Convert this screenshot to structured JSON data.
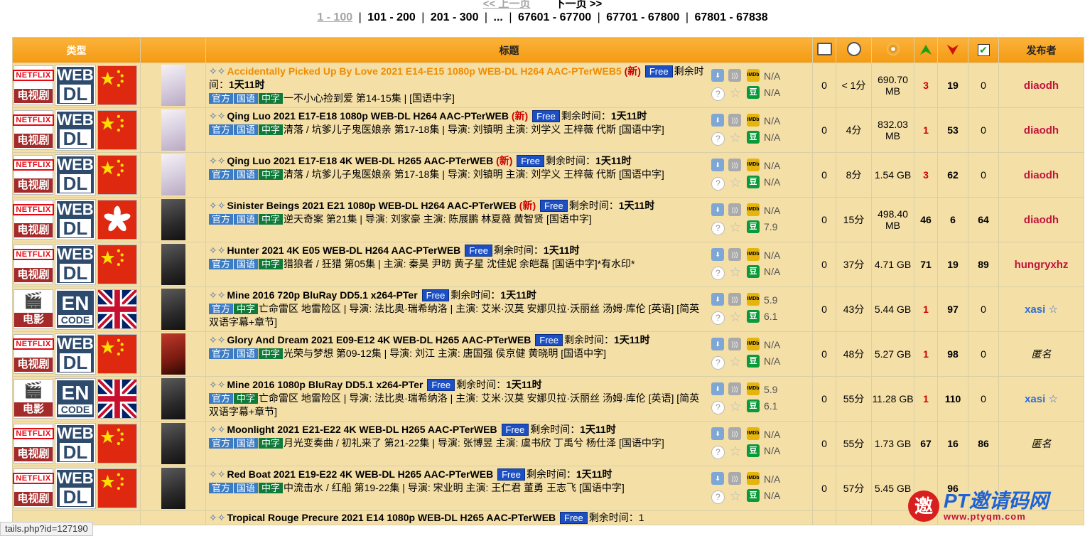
{
  "pager": {
    "prev_label": "<< 上一页",
    "next_label": "下一页 >>",
    "current": "1 - 100",
    "pages": [
      "101 - 200",
      "201 - 300",
      "...",
      "67601 - 67700",
      "67701 - 67800",
      "67801 - 67838"
    ]
  },
  "headers": {
    "type": "类型",
    "title": "标题",
    "publisher": "发布者"
  },
  "icons": {
    "comments": "comment-icon",
    "time": "clock-icon",
    "size": "disk-icon",
    "seeders": "up-arrow-icon",
    "leechers": "down-arrow-icon",
    "completed": "check-icon"
  },
  "labels": {
    "remaining": "剩余时间：",
    "free": "Free",
    "new": "(新)",
    "tag_official": "官方",
    "tag_mandarin": "国语",
    "tag_chinese_sub": "中字",
    "tag_english": "英语"
  },
  "rows": [
    {
      "cat": "电视剧",
      "cat_logo": "NETFLIX",
      "src": "WEB DL",
      "flag": "cn",
      "title": "Accidentally Picked Up By Love 2021 E14-E15 1080p WEB-DL H264 AAC-PTerWEB5",
      "hot": true,
      "new": true,
      "remain": "1天11时",
      "sub": "一不小心捡到爱 第14-15集 | [国语中字]",
      "tags": [
        "官方",
        "国语",
        "中字"
      ],
      "imdb": "N/A",
      "douban": "N/A",
      "comments": "0",
      "time": "< 1分",
      "size": "690.70 MB",
      "seeders": "3",
      "leechers": "19",
      "completed": "0",
      "publisher": "diaodh"
    },
    {
      "cat": "电视剧",
      "cat_logo": "NETFLIX",
      "src": "WEB DL",
      "flag": "cn",
      "title": "Qing Luo 2021 E17-E18 1080p WEB-DL H264 AAC-PTerWEB",
      "hot": false,
      "new": true,
      "remain": "1天11时",
      "sub": "清落 / 坑爹儿子鬼医娘亲 第17-18集 | 导演: 刘镇明 主演: 刘学义 王梓薇 代斯 [国语中字]",
      "tags": [
        "官方",
        "国语",
        "中字"
      ],
      "imdb": "N/A",
      "douban": "N/A",
      "comments": "0",
      "time": "4分",
      "size": "832.03 MB",
      "seeders": "1",
      "leechers": "53",
      "completed": "0",
      "publisher": "diaodh"
    },
    {
      "cat": "电视剧",
      "cat_logo": "NETFLIX",
      "src": "WEB DL",
      "flag": "cn",
      "title": "Qing Luo 2021 E17-E18 4K WEB-DL H265 AAC-PTerWEB",
      "hot": false,
      "new": true,
      "remain": "1天11时",
      "sub": "清落 / 坑爹儿子鬼医娘亲 第17-18集 | 导演: 刘镇明 主演: 刘学义 王梓薇 代斯 [国语中字]",
      "tags": [
        "官方",
        "国语",
        "中字"
      ],
      "imdb": "N/A",
      "douban": "N/A",
      "comments": "0",
      "time": "8分",
      "size": "1.54 GB",
      "seeders": "3",
      "leechers": "62",
      "completed": "0",
      "publisher": "diaodh"
    },
    {
      "cat": "电视剧",
      "cat_logo": "NETFLIX",
      "src": "WEB DL",
      "flag": "hk",
      "title": "Sinister Beings 2021 E21 1080p WEB-DL H264 AAC-PTerWEB",
      "hot": false,
      "new": true,
      "remain": "1天11时",
      "sub": "逆天奇案 第21集 | 导演: 刘家豪 主演: 陈展鹏 林夏薇 黄智贤 [国语中字]",
      "tags": [
        "官方",
        "国语",
        "中字"
      ],
      "imdb": "N/A",
      "douban": "7.9",
      "comments": "0",
      "time": "15分",
      "size": "498.40 MB",
      "seeders": "46",
      "leechers": "6",
      "completed": "64",
      "publisher": "diaodh"
    },
    {
      "cat": "电视剧",
      "cat_logo": "NETFLIX",
      "src": "WEB DL",
      "flag": "cn",
      "title": "Hunter 2021 4K E05 WEB-DL H264 AAC-PTerWEB",
      "hot": false,
      "new": false,
      "remain": "1天11时",
      "sub": "猎狼者 / 狂猎 第05集 | 主演: 秦昊 尹昉 黄子星 沈佳妮 余皑磊 [国语中字]*有水印*",
      "tags": [
        "官方",
        "国语",
        "中字"
      ],
      "imdb": "N/A",
      "douban": "N/A",
      "comments": "0",
      "time": "37分",
      "size": "4.71 GB",
      "seeders": "71",
      "leechers": "19",
      "completed": "89",
      "publisher": "hungryxhz"
    },
    {
      "cat": "电影",
      "cat_logo": "🎬",
      "src": "EN CODE",
      "flag": "uk",
      "title": "Mine 2016 720p BluRay DD5.1 x264-PTer",
      "hot": false,
      "new": false,
      "remain": "1天11时",
      "sub": "亡命雷区 地雷险区 | 导演: 法比奥·瑞希纳洛 | 主演: 艾米·汉莫 安娜贝拉·沃丽丝 汤姆·库伦 [英语] [简英双语字幕+章节]",
      "tags": [
        "官方",
        "中字"
      ],
      "imdb": "5.9",
      "douban": "6.1",
      "comments": "0",
      "time": "43分",
      "size": "5.44 GB",
      "seeders": "1",
      "leechers": "97",
      "completed": "0",
      "publisher": "xasi ☆"
    },
    {
      "cat": "电视剧",
      "cat_logo": "NETFLIX",
      "src": "WEB DL",
      "flag": "cn",
      "title": "Glory And Dream 2021 E09-E12 4K WEB-DL H265 AAC-PTerWEB",
      "hot": false,
      "new": false,
      "remain": "1天11时",
      "sub": "光荣与梦想 第09-12集 | 导演: 刘江 主演: 唐国强 侯京健 黄晓明 [国语中字]",
      "tags": [
        "官方",
        "国语",
        "中字"
      ],
      "imdb": "N/A",
      "douban": "N/A",
      "comments": "0",
      "time": "48分",
      "size": "5.27 GB",
      "seeders": "1",
      "leechers": "98",
      "completed": "0",
      "publisher": "匿名"
    },
    {
      "cat": "电影",
      "cat_logo": "🎬",
      "src": "EN CODE",
      "flag": "uk",
      "title": "Mine 2016 1080p BluRay DD5.1 x264-PTer",
      "hot": false,
      "new": false,
      "remain": "1天11时",
      "sub": "亡命雷区 地雷险区 | 导演: 法比奥·瑞希纳洛 | 主演: 艾米·汉莫 安娜贝拉·沃丽丝 汤姆·库伦 [英语] [简英双语字幕+章节]",
      "tags": [
        "官方",
        "中字"
      ],
      "imdb": "5.9",
      "douban": "6.1",
      "comments": "0",
      "time": "55分",
      "size": "11.28 GB",
      "seeders": "1",
      "leechers": "110",
      "completed": "0",
      "publisher": "xasi ☆"
    },
    {
      "cat": "电视剧",
      "cat_logo": "NETFLIX",
      "src": "WEB DL",
      "flag": "cn",
      "title": "Moonlight 2021 E21-E22 4K WEB-DL H265 AAC-PTerWEB",
      "hot": false,
      "new": false,
      "remain": "1天11时",
      "sub": "月光变奏曲 / 初礼来了 第21-22集 | 导演: 张博昱 主演: 虞书欣 丁禹兮 杨仕泽 [国语中字]",
      "tags": [
        "官方",
        "国语",
        "中字"
      ],
      "imdb": "N/A",
      "douban": "N/A",
      "comments": "0",
      "time": "55分",
      "size": "1.73 GB",
      "seeders": "67",
      "leechers": "16",
      "completed": "86",
      "publisher": "匿名"
    },
    {
      "cat": "电视剧",
      "cat_logo": "NETFLIX",
      "src": "WEB DL",
      "flag": "cn",
      "title": "Red Boat 2021 E19-E22 4K WEB-DL H265 AAC-PTerWEB",
      "hot": false,
      "new": false,
      "remain": "1天11时",
      "sub": "中流击水 / 红船 第19-22集 | 导演: 宋业明 主演: 王仁君 董勇 王志飞 [国语中字]",
      "tags": [
        "官方",
        "国语",
        "中字"
      ],
      "imdb": "N/A",
      "douban": "N/A",
      "comments": "0",
      "time": "57分",
      "size": "5.45 GB",
      "seeders": "",
      "leechers": "96",
      "completed": "",
      "publisher": ""
    }
  ],
  "last_row_title": "Tropical Rouge Precure 2021 E14 1080p WEB-DL H265 AAC-PTerWEB",
  "last_row_remain": "剩余时间：1",
  "watermark": {
    "title": "PT邀请码网",
    "url": "www.ptyqm.com"
  },
  "status_url": "tails.php?id=127190"
}
